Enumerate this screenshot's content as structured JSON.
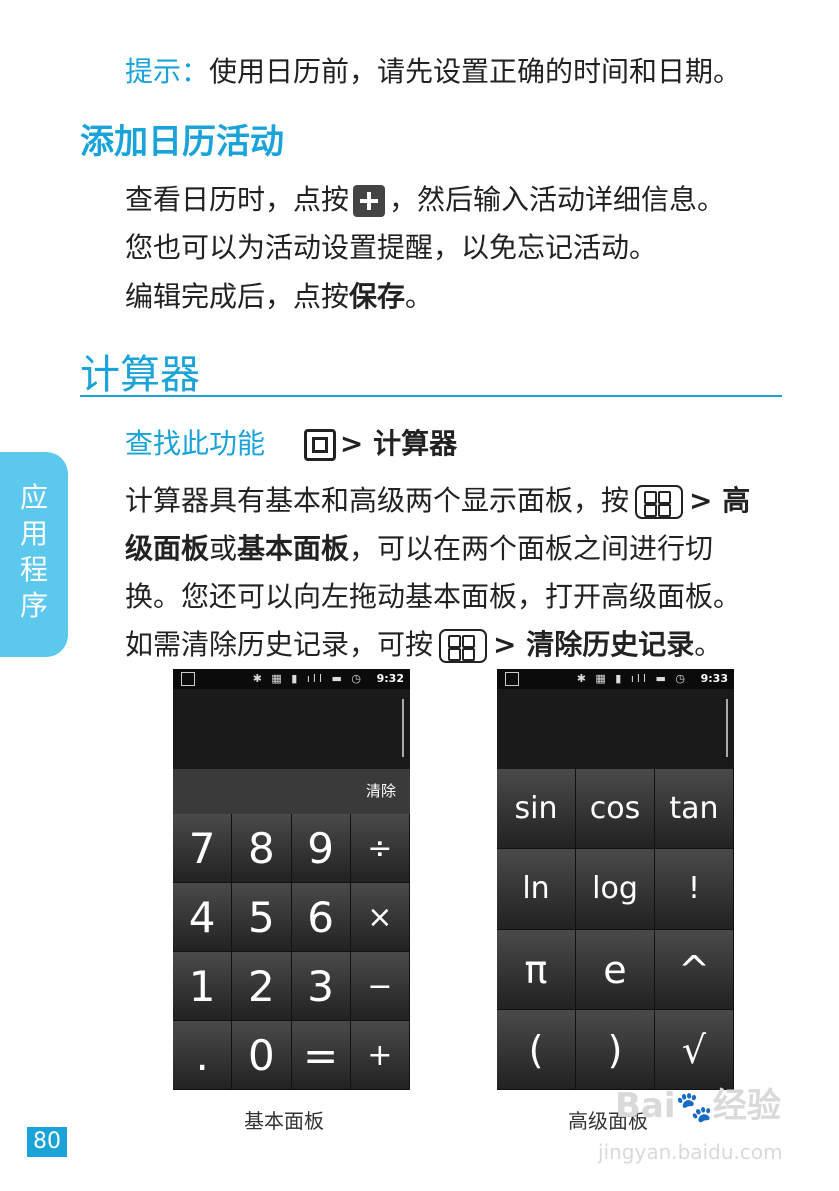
{
  "tip": {
    "label": "提示：",
    "text": "使用日历前，请先设置正确的时间和日期。"
  },
  "section_add_event": {
    "heading": "添加日历活动",
    "para1_a": "查看日历时，点按",
    "para1_b": "，然后输入活动详细信息。",
    "para1_line2": "您也可以为活动设置提醒，以免忘记活动。",
    "para2_a": "编辑完成后，点按",
    "para2_bold": "保存",
    "para2_b": "。"
  },
  "section_calculator": {
    "heading": "计算器",
    "find_label": "查找此功能",
    "find_path": "> 计算器",
    "line1_a": "计算器具有基本和高级两个显示面板，按",
    "line1_b": "> 高",
    "line2_bold1": "级面板",
    "line2_mid": "或",
    "line2_bold2": "基本面板",
    "line2_rest": "，可以在两个面板之间进行切",
    "line3": "换。您还可以向左拖动基本面板，打开高级面板。",
    "line4_a": "如需清除历史记录，可按",
    "line4_bold": "> 清除历史记录",
    "line4_b": "。"
  },
  "side_tab": {
    "line1": "应",
    "line2": "用",
    "line3": "程",
    "line4": "序"
  },
  "page_number": "80",
  "basic_panel": {
    "time": "9:32",
    "clear_label": "清除",
    "keys": [
      "7",
      "8",
      "9",
      "÷",
      "4",
      "5",
      "6",
      "×",
      "1",
      "2",
      "3",
      "−",
      ".",
      "0",
      "=",
      "+"
    ],
    "caption": "基本面板"
  },
  "advanced_panel": {
    "time": "9:33",
    "keys": [
      "sin",
      "cos",
      "tan",
      "ln",
      "log",
      "!",
      "π",
      "e",
      "^",
      "(",
      ")",
      "√"
    ],
    "caption": "高级面板"
  },
  "watermark": {
    "brand": "Bai",
    "brand2": "经验",
    "url": "jingyan.baidu.com"
  },
  "colors": {
    "accent": "#1aa3d9",
    "tab": "#5cc8ee",
    "key_dark": "#2a2a2a"
  }
}
